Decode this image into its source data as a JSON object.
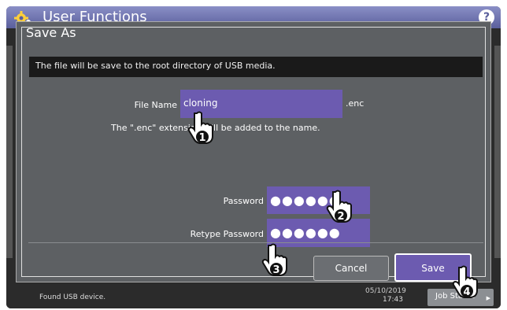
{
  "app": {
    "title": "User Functions",
    "help_glyph": "?"
  },
  "dialog": {
    "title": "Save As",
    "message": "The file will be save to the root directory of USB media.",
    "file_name": {
      "label": "File Name",
      "value": "cloning",
      "extension": ".enc"
    },
    "extension_note": "The \".enc\" extension will be added to the name.",
    "password": {
      "label": "Password",
      "masked": "●●●●●●"
    },
    "retype_password": {
      "label": "Retype Password",
      "masked": "●●●●●●"
    },
    "buttons": {
      "cancel": "Cancel",
      "save": "Save"
    }
  },
  "statusbar": {
    "message": "Found USB device.",
    "date": "05/10/2019",
    "time": "17:43",
    "job_button": "Job Status"
  },
  "callouts": [
    "1",
    "2",
    "3",
    "4"
  ],
  "colors": {
    "accent": "#6c5bb0",
    "title_bar": "#5a5f9c",
    "dialog_bg": "#5d6063"
  }
}
